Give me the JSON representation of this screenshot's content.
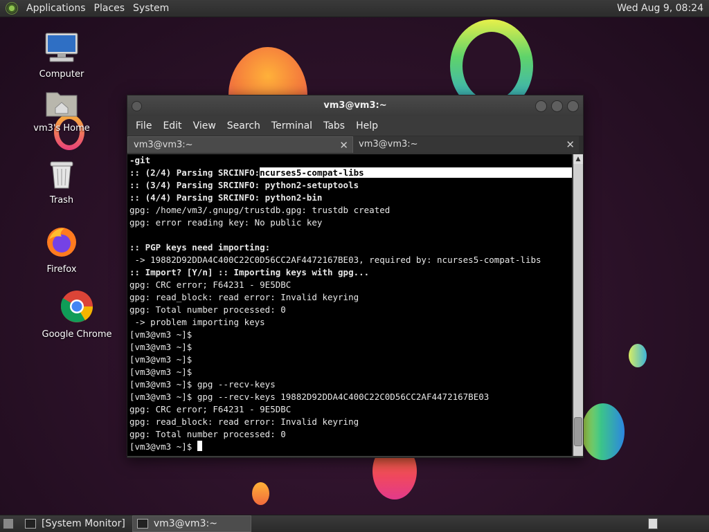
{
  "top_panel": {
    "menus": [
      "Applications",
      "Places",
      "System"
    ],
    "clock": "Wed Aug  9, 08:24"
  },
  "desktop_icons": [
    {
      "label": "Computer",
      "icon": "computer-icon"
    },
    {
      "label": "vm3's Home",
      "icon": "home-folder-icon"
    },
    {
      "label": "Trash",
      "icon": "trash-icon"
    },
    {
      "label": "Firefox",
      "icon": "firefox-icon"
    },
    {
      "label": "Google Chrome",
      "icon": "chrome-icon"
    }
  ],
  "window": {
    "title": "vm3@vm3:~",
    "menu": [
      "File",
      "Edit",
      "View",
      "Search",
      "Terminal",
      "Tabs",
      "Help"
    ],
    "tabs": [
      {
        "label": "vm3@vm3:~",
        "active": true
      },
      {
        "label": "vm3@vm3:~",
        "active": false
      }
    ]
  },
  "terminal": {
    "lines": [
      {
        "text": "-git",
        "bold": true
      },
      {
        "pre": ":: (2/4) Parsing SRCINFO:",
        "hl": "ncurses5-compat-libs",
        "bold": true
      },
      {
        "text": ":: (3/4) Parsing SRCINFO: python2-setuptools",
        "bold": true
      },
      {
        "text": ":: (4/4) Parsing SRCINFO: python2-bin",
        "bold": true
      },
      {
        "text": "gpg: /home/vm3/.gnupg/trustdb.gpg: trustdb created"
      },
      {
        "text": "gpg: error reading key: No public key"
      },
      {
        "text": ""
      },
      {
        "text": ":: PGP keys need importing:",
        "bold": true
      },
      {
        "text": " -> 19882D92DDA4C400C22C0D56CC2AF4472167BE03, required by: ncurses5-compat-libs"
      },
      {
        "text": ":: Import? [Y/n] :: Importing keys with gpg...",
        "bold": true
      },
      {
        "text": "gpg: CRC error; F64231 - 9E5DBC"
      },
      {
        "text": "gpg: read_block: read error: Invalid keyring"
      },
      {
        "text": "gpg: Total number processed: 0"
      },
      {
        "text": " -> problem importing keys"
      },
      {
        "text": "[vm3@vm3 ~]$"
      },
      {
        "text": "[vm3@vm3 ~]$"
      },
      {
        "text": "[vm3@vm3 ~]$"
      },
      {
        "text": "[vm3@vm3 ~]$"
      },
      {
        "text": "[vm3@vm3 ~]$ gpg --recv-keys"
      },
      {
        "text": "[vm3@vm3 ~]$ gpg --recv-keys 19882D92DDA4C400C22C0D56CC2AF4472167BE03"
      },
      {
        "text": "gpg: CRC error; F64231 - 9E5DBC"
      },
      {
        "text": "gpg: read_block: read error: Invalid keyring"
      },
      {
        "text": "gpg: Total number processed: 0"
      }
    ],
    "prompt": "[vm3@vm3 ~]$ "
  },
  "bottom_panel": {
    "tasks": [
      {
        "label": "[System Monitor]",
        "active": false
      },
      {
        "label": "vm3@vm3:~",
        "active": true
      }
    ]
  }
}
